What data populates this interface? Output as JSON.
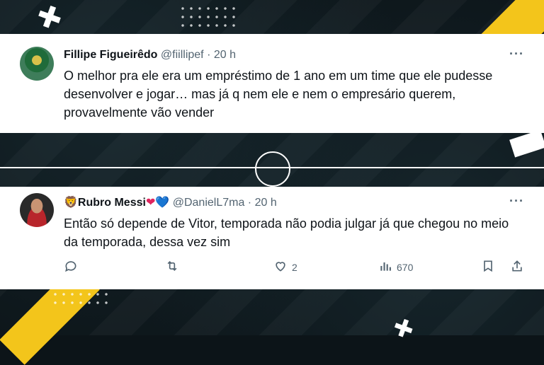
{
  "tweets": [
    {
      "name": "Fillipe Figueirêdo",
      "handle": "@fiillipef",
      "separator": "·",
      "time": "20 h",
      "text": "O melhor pra ele era um empréstimo de 1 ano em um time que ele pudesse desenvolver e jogar… mas já q nem ele e nem o empresário querem, provavelmente vão vender",
      "more": "···"
    },
    {
      "name_prefix_emoji": "🦁",
      "name": "Rubro Messi",
      "name_suffix_hearts": [
        "❤",
        "💙"
      ],
      "handle": "@DanielL7ma",
      "separator": "·",
      "time": "20 h",
      "text": "Então só depende de Vitor, temporada não podia julgar já que chegou no meio da temporada, dessa vez sim",
      "more": "···",
      "actions": {
        "reply_count": "",
        "retweet_count": "",
        "like_count": "2",
        "views_count": "670"
      }
    }
  ],
  "icons": [
    "reply-icon",
    "retweet-icon",
    "like-icon",
    "views-icon",
    "bookmark-icon",
    "share-icon"
  ],
  "colors": {
    "background": "#0c1418",
    "accent_yellow": "#f3c51b",
    "text_primary": "#0f1419",
    "text_secondary": "#536471"
  }
}
